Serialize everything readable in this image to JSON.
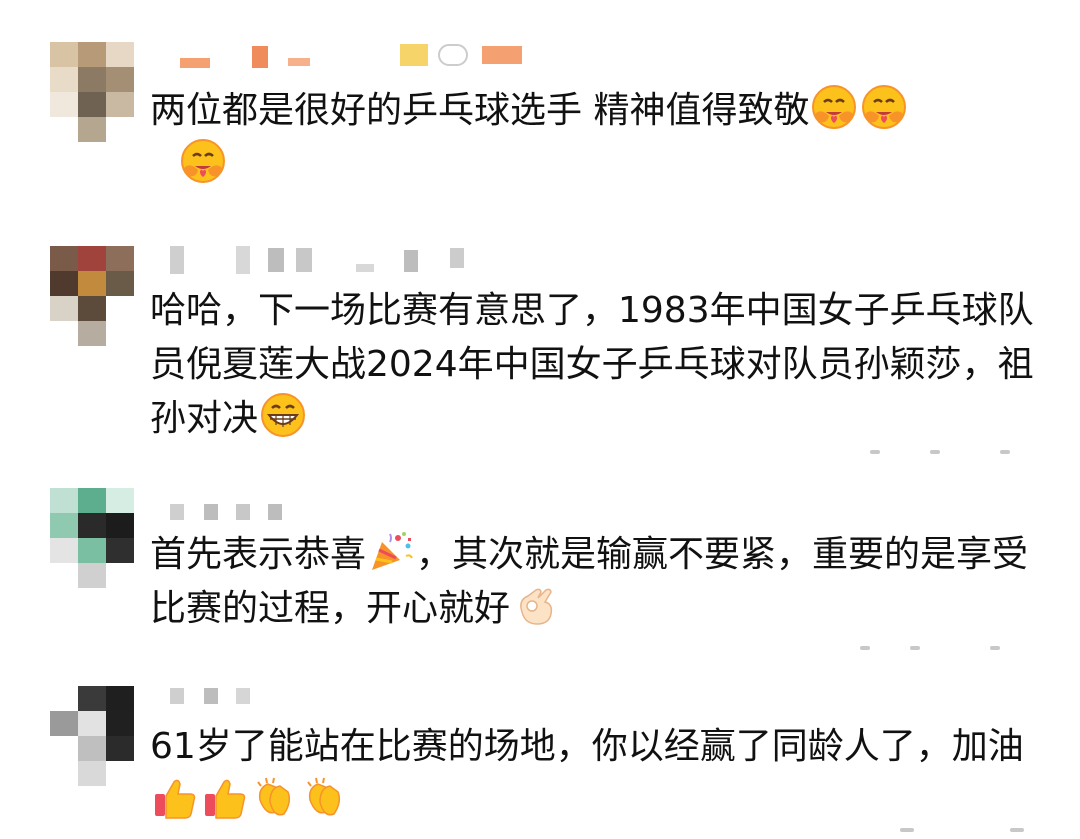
{
  "comments": [
    {
      "text": "两位都是很好的乒乓球选手  精神值得致敬",
      "emojis": [
        "hug-face-icon",
        "hug-face-icon",
        "hug-face-icon"
      ]
    },
    {
      "text": "哈哈，下一场比赛有意思了，1983年中国女子乒乓球队员倪夏莲大战2024年中国女子乒乓球对队员孙颖莎，祖孙对决",
      "emojis": [
        "grinning-face-icon"
      ]
    },
    {
      "text_before": "首先表示恭喜",
      "text_after": "，其次就是输赢不要紧，重要的是享受比赛的过程，开心就好",
      "emojis": [
        "party-popper-icon",
        "ok-hand-icon"
      ]
    },
    {
      "text": "61岁了能站在比赛的场地，你以经赢了同龄人了，加油",
      "emojis": [
        "thumbs-up-icon",
        "thumbs-up-icon",
        "clapping-hands-icon",
        "clapping-hands-icon"
      ]
    }
  ],
  "colors": {
    "text": "#111111",
    "emoji_yellow": "#fcc21b",
    "emoji_orange": "#f79329",
    "heart_red": "#ed4c5c"
  }
}
